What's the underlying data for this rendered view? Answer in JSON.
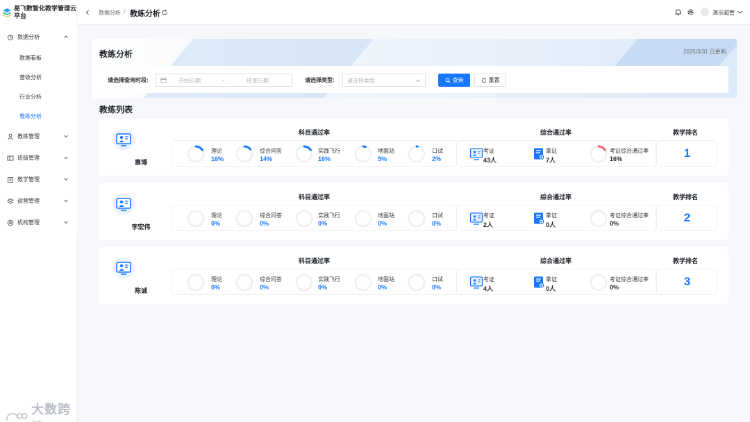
{
  "app": {
    "title": "易飞数智化教学管理云平台"
  },
  "sidebar": {
    "groups": [
      {
        "label": "数据分析",
        "icon": "chart-icon",
        "expanded": true,
        "items": [
          {
            "label": "数据看板",
            "active": false
          },
          {
            "label": "营收分析",
            "active": false
          },
          {
            "label": "行业分析",
            "active": false
          },
          {
            "label": "教练分析",
            "active": true
          }
        ]
      },
      {
        "label": "教练管理",
        "icon": "person-icon"
      },
      {
        "label": "班级管理",
        "icon": "class-icon"
      },
      {
        "label": "教学管理",
        "icon": "book-icon"
      },
      {
        "label": "运营管理",
        "icon": "layers-icon"
      },
      {
        "label": "机构管理",
        "icon": "building-icon"
      }
    ]
  },
  "watermark": {
    "text": "大数跨境"
  },
  "header": {
    "breadcrumb_parent": "数据分析",
    "breadcrumb_current": "教练分析",
    "user": "演示超管"
  },
  "page": {
    "title": "教练分析",
    "updated": "2025/3/31 已更新",
    "list_title": "教练列表"
  },
  "filter": {
    "date_label": "请选择查询时段:",
    "start_placeholder": "开始日期",
    "date_separator": "-",
    "end_placeholder": "结束日期",
    "type_label": "请选择类型:",
    "type_placeholder": "请选择类型",
    "query_label": "查询",
    "reset_label": "重置"
  },
  "headers": {
    "subject_pass_rate": "科目通过率",
    "overall_pass_rate": "综合通过率",
    "teaching_rank": "教学排名"
  },
  "colors": {
    "primary": "#1677ff",
    "ring_track": "#eef1f5",
    "ring_red": "#f0646a"
  },
  "coaches": [
    {
      "name": "惠博",
      "subjects": [
        {
          "label": "理论",
          "value": "16%",
          "rate": 0.16
        },
        {
          "label": "综合问答",
          "value": "14%",
          "rate": 0.14
        },
        {
          "label": "实践飞行",
          "value": "16%",
          "rate": 0.16
        },
        {
          "label": "地面站",
          "value": "5%",
          "rate": 0.05
        },
        {
          "label": "口试",
          "value": "2%",
          "rate": 0.02
        }
      ],
      "overall": [
        {
          "label": "考证",
          "value": "43人"
        },
        {
          "label": "拿证",
          "value": "7人"
        },
        {
          "label": "考证综合通过率",
          "value": "16%",
          "rate": 0.16
        }
      ],
      "rank": "1"
    },
    {
      "name": "李宏伟",
      "subjects": [
        {
          "label": "理论",
          "value": "0%",
          "rate": 0
        },
        {
          "label": "综合问答",
          "value": "0%",
          "rate": 0
        },
        {
          "label": "实践飞行",
          "value": "0%",
          "rate": 0
        },
        {
          "label": "地面站",
          "value": "0%",
          "rate": 0
        },
        {
          "label": "口试",
          "value": "0%",
          "rate": 0
        }
      ],
      "overall": [
        {
          "label": "考证",
          "value": "2人"
        },
        {
          "label": "拿证",
          "value": "0人"
        },
        {
          "label": "考证综合通过率",
          "value": "0%",
          "rate": 0
        }
      ],
      "rank": "2"
    },
    {
      "name": "陈诚",
      "subjects": [
        {
          "label": "理论",
          "value": "0%",
          "rate": 0
        },
        {
          "label": "综合问答",
          "value": "0%",
          "rate": 0
        },
        {
          "label": "实践飞行",
          "value": "0%",
          "rate": 0
        },
        {
          "label": "地面站",
          "value": "0%",
          "rate": 0
        },
        {
          "label": "口试",
          "value": "0%",
          "rate": 0
        }
      ],
      "overall": [
        {
          "label": "考证",
          "value": "4人"
        },
        {
          "label": "拿证",
          "value": "0人"
        },
        {
          "label": "考证综合通过率",
          "value": "0%",
          "rate": 0
        }
      ],
      "rank": "3"
    }
  ]
}
